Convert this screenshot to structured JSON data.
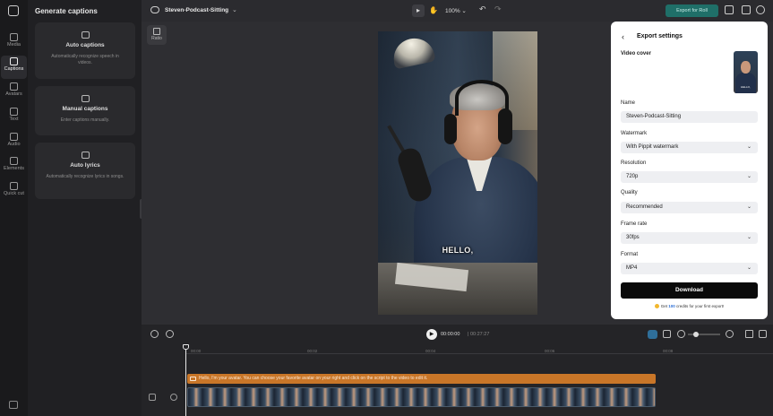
{
  "rail": {
    "items": [
      {
        "label": "Media",
        "icon": "media-icon"
      },
      {
        "label": "Captions",
        "icon": "captions-icon",
        "active": true
      },
      {
        "label": "Avatars",
        "icon": "avatars-icon"
      },
      {
        "label": "Text",
        "icon": "text-icon"
      },
      {
        "label": "Audio",
        "icon": "audio-icon"
      },
      {
        "label": "Elements",
        "icon": "elements-icon"
      },
      {
        "label": "Quick cut",
        "icon": "scissors-icon"
      }
    ]
  },
  "panel": {
    "title": "Generate captions",
    "cards": [
      {
        "title": "Auto captions",
        "desc": "Automatically recognize speech in videos.",
        "icon": "cc-icon"
      },
      {
        "title": "Manual captions",
        "desc": "Enter captions manually.",
        "icon": "cc-icon"
      },
      {
        "title": "Auto lyrics",
        "desc": "Automatically recognize lyrics in songs.",
        "icon": "music-icon"
      }
    ]
  },
  "topbar": {
    "project_name": "Steven-Podcast-Sitting",
    "zoom": "100%",
    "export_label": "Export for Roll",
    "accent": "#1f6f68"
  },
  "canvas": {
    "ratio_label": "Ratio",
    "video_caption": "HELLO,"
  },
  "export": {
    "title": "Export settings",
    "video_cover_label": "Video cover",
    "cover_caption": "HELLO,",
    "name_label": "Name",
    "name_value": "Steven-Podcast-Sitting",
    "watermark_label": "Watermark",
    "watermark_value": "With Pippit watermark",
    "resolution_label": "Resolution",
    "resolution_value": "720p",
    "quality_label": "Quality",
    "quality_value": "Recommended",
    "framerate_label": "Frame rate",
    "framerate_value": "30fps",
    "format_label": "Format",
    "format_value": "MP4",
    "download_label": "Download",
    "credits_pre": "Get",
    "credits_num": "100",
    "credits_post": "credits for your first export!"
  },
  "timeline": {
    "current_time": "00:00:00",
    "duration": "00:27:27",
    "ticks": [
      "00:00",
      "00:02",
      "00:04",
      "00:06",
      "00:08"
    ],
    "caption_text": "Hello, I'm your avatar. You can choose your favorite avatar on your right and click on the script to the video to edit it."
  }
}
